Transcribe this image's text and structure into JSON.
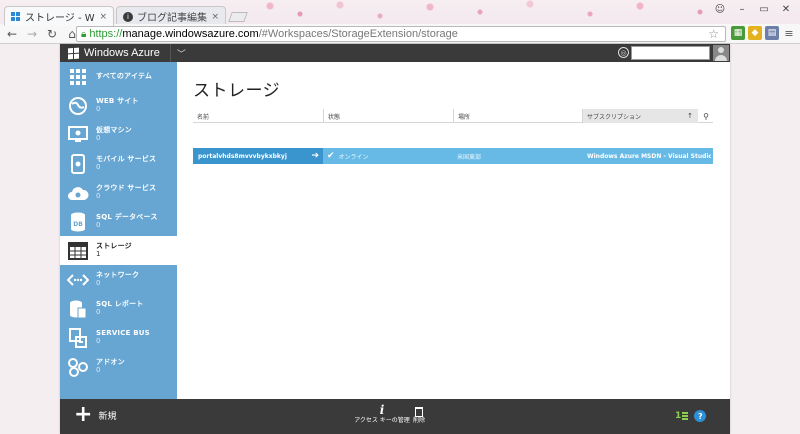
{
  "browser": {
    "tabs": [
      {
        "title": "ストレージ - Windows Azu",
        "close": "×"
      },
      {
        "title": "ブログ記事編集 - はてなブロ",
        "close": "×"
      }
    ],
    "url": {
      "scheme": "https://",
      "host": "manage.windowsazure.com",
      "path": "/#Workspaces/StorageExtension/storage"
    }
  },
  "portal": {
    "brand": "Windows Azure",
    "sidebar": {
      "items": [
        {
          "label": "すべてのアイテム",
          "count": "",
          "icon": "grid-icon"
        },
        {
          "label": "WEB サイト",
          "count": "0",
          "icon": "globe-icon"
        },
        {
          "label": "仮想マシン",
          "count": "0",
          "icon": "monitor-icon"
        },
        {
          "label": "モバイル サービス",
          "count": "0",
          "icon": "mobile-icon"
        },
        {
          "label": "クラウド サービス",
          "count": "0",
          "icon": "cloud-icon"
        },
        {
          "label": "SQL データベース",
          "count": "0",
          "icon": "database-icon"
        },
        {
          "label": "ストレージ",
          "count": "1",
          "icon": "table-icon"
        },
        {
          "label": "ネットワーク",
          "count": "0",
          "icon": "network-icon"
        },
        {
          "label": "SQL レポート",
          "count": "0",
          "icon": "report-icon"
        },
        {
          "label": "SERVICE BUS",
          "count": "0",
          "icon": "servicebus-icon"
        },
        {
          "label": "アドオン",
          "count": "0",
          "icon": "addon-icon"
        }
      ]
    },
    "page_title": "ストレージ",
    "grid": {
      "columns": [
        "名前",
        "状態",
        "場所",
        "サブスクリプション"
      ],
      "rows": [
        {
          "name": "portalvhds8mvvvbykxbkyj",
          "status": "オンライン",
          "location": "米国東部",
          "subscription": "Windows Azure MSDN - Visual Studio U..."
        }
      ]
    },
    "commands": {
      "new": "新規",
      "access_keys": "アクセス キーの管理",
      "delete": "削除",
      "notification_count": "1"
    }
  }
}
